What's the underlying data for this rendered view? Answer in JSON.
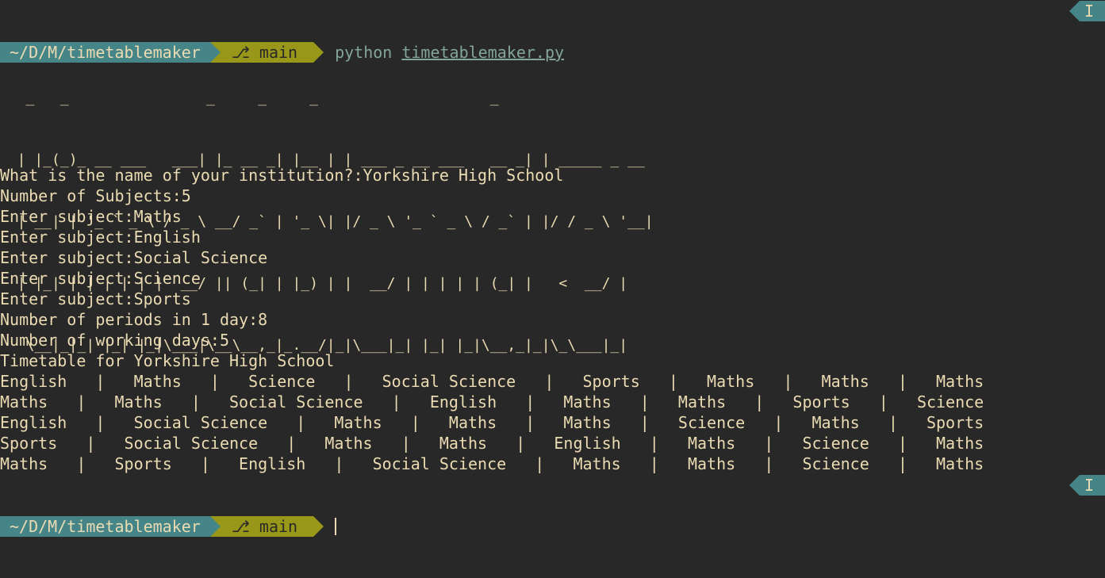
{
  "prompt_top": {
    "path": "~/D/M/timetablemaker",
    "branch_icon": "git-branch-icon",
    "branch": "main",
    "command": "python",
    "command_arg": "timetablemaker.py",
    "mode": "I"
  },
  "banner": [
    "   _   _                _     _     _                    _",
    "  | |_(_)_ __ ___   ___| |_ __ _| |__ | | ___ _ __ ___   __ _| | _____ _ __",
    "  | __| | '_ ` _ \\ / _ \\ __/ _` | '_ \\| |/ _ \\ '_ ` _ \\ / _` | |/ / _ \\ '__|",
    "  | |_| | | | | | |  __/ || (_| | |_) | |  __/ | | | | | (_| |   <  __/ |",
    "   \\__|_|_| |_| |_|\\___|\\__\\__,_|_.__/|_|\\___|_| |_| |_|\\__,_|_|\\_\\___|_|"
  ],
  "dialog": [
    "What is the name of your institution?:Yorkshire High School",
    "Number of Subjects:5",
    "Enter subject:Maths",
    "Enter subject:English",
    "Enter subject:Social Science",
    "Enter subject:Science",
    "Enter subject:Sports",
    "Number of periods in 1 day:8",
    "Number of working days:5",
    "Timetable for Yorkshire High School"
  ],
  "timetable": [
    "English   |   Maths   |   Science   |   Social Science   |   Sports   |   Maths   |   Maths   |   Maths",
    "Maths   |   Maths   |   Social Science   |   English   |   Maths   |   Maths   |   Sports   |   Science",
    "English   |   Social Science   |   Maths   |   Maths   |   Maths   |   Science   |   Maths   |   Sports",
    "Sports   |   Social Science   |   Maths   |   Maths   |   English   |   Maths   |   Science   |   Maths",
    "Maths   |   Sports   |   English   |   Social Science   |   Maths   |   Maths   |   Science   |   Maths"
  ],
  "prompt_bottom": {
    "path": "~/D/M/timetablemaker",
    "branch_icon": "git-branch-icon",
    "branch": "main",
    "mode": "I"
  },
  "colors": {
    "background": "#282828",
    "foreground": "#ebdbb2",
    "path_segment": "#458588",
    "git_segment": "#98971a",
    "command": "#83a598"
  }
}
